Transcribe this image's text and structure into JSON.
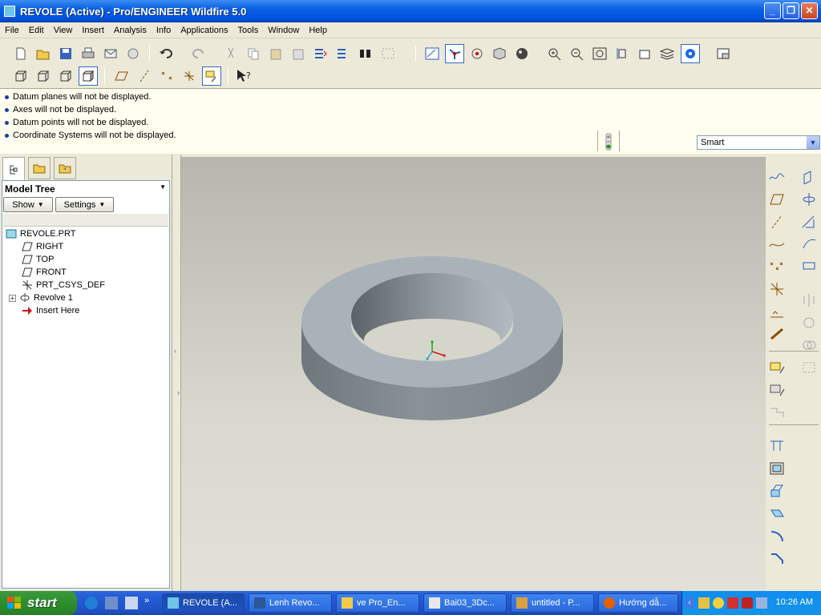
{
  "window": {
    "title": "REVOLE (Active) - Pro/ENGINEER Wildfire 5.0"
  },
  "menu": [
    "File",
    "Edit",
    "View",
    "Insert",
    "Analysis",
    "Info",
    "Applications",
    "Tools",
    "Window",
    "Help"
  ],
  "messages": [
    "Datum planes will not be displayed.",
    "Axes will not be displayed.",
    "Datum points will not be displayed.",
    "Coordinate Systems will not be displayed."
  ],
  "filter": {
    "selected": "Smart"
  },
  "model_tree": {
    "title": "Model Tree",
    "show_label": "Show",
    "settings_label": "Settings",
    "items": [
      {
        "label": "REVOLE.PRT",
        "icon": "part-icon"
      },
      {
        "label": "RIGHT",
        "icon": "datum-plane-icon"
      },
      {
        "label": "TOP",
        "icon": "datum-plane-icon"
      },
      {
        "label": "FRONT",
        "icon": "datum-plane-icon"
      },
      {
        "label": "PRT_CSYS_DEF",
        "icon": "csys-icon"
      },
      {
        "label": "Revolve 1",
        "icon": "revolve-icon"
      },
      {
        "label": "Insert Here",
        "icon": "insert-arrow-icon"
      }
    ]
  },
  "taskbar": {
    "start": "start",
    "tasks": [
      "REVOLE (A...",
      "Lenh Revo...",
      "ve Pro_En...",
      "Bai03_3Dc...",
      "untitled - P...",
      "Hướng dẫ..."
    ],
    "clock": "10:26 AM"
  },
  "colors": {
    "title_blue": "#0054e3",
    "taskbar_blue": "#245edb",
    "start_green": "#2d8e2d",
    "model_gray": "#9aa3ab"
  }
}
